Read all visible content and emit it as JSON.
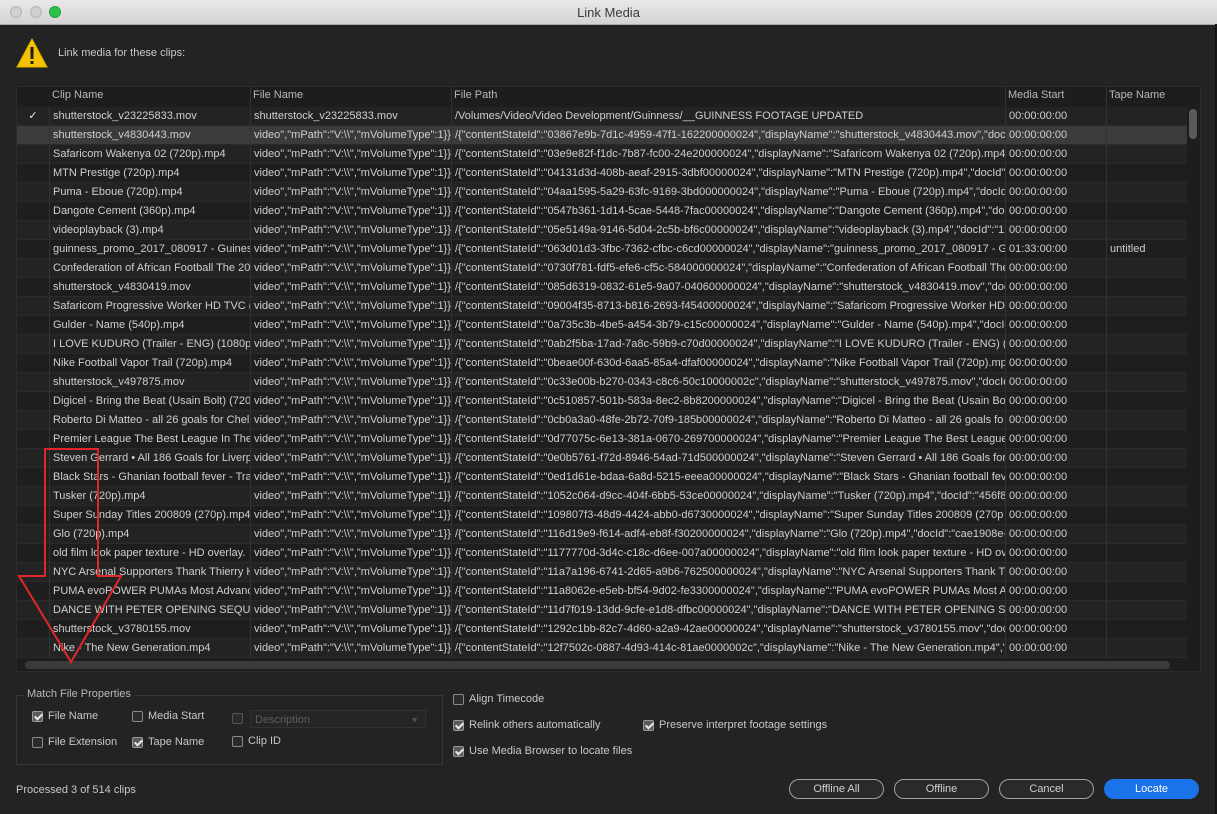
{
  "window": {
    "title": "Link Media"
  },
  "header": {
    "warning_text": "Link media for these clips:"
  },
  "table": {
    "columns": [
      "Clip Name",
      "File Name",
      "File Path",
      "Media Start",
      "Tape Name"
    ],
    "rows": [
      {
        "check": "✓",
        "clip": "shutterstock_v23225833.mov",
        "file": "shutterstock_v23225833.mov",
        "path": "/Volumes/Video/Video Development/Guinness/__GUINNESS FOOTAGE UPDATED",
        "start": "00:00:00:00",
        "tape": "",
        "selected": false
      },
      {
        "check": "",
        "clip": "shutterstock_v4830443.mov",
        "file": "video\",\"mPath\":\"V:\\\\\",\"mVolumeType\":1}}",
        "path": "/{\"contentStateId\":\"03867e9b-7d1c-4959-47f1-162200000024\",\"displayName\":\"shutterstock_v4830443.mov\",\"docId\"",
        "start": "00:00:00:00",
        "tape": "",
        "selected": true
      },
      {
        "check": "",
        "clip": "Safaricom Wakenya 02 (720p).mp4",
        "file": "video\",\"mPath\":\"V:\\\\\",\"mVolumeType\":1}}",
        "path": "/{\"contentStateId\":\"03e9e82f-f1dc-7b87-fc00-24e200000024\",\"displayName\":\"Safaricom Wakenya 02 (720p).mp4\",\"docId\"",
        "start": "00:00:00:00",
        "tape": "",
        "selected": false
      },
      {
        "check": "",
        "clip": "MTN Prestige (720p).mp4",
        "file": "video\",\"mPath\":\"V:\\\\\",\"mVolumeType\":1}}",
        "path": "/{\"contentStateId\":\"04131d3d-408b-aeaf-2915-3dbf00000024\",\"displayName\":\"MTN Prestige (720p).mp4\",\"docId\":\"",
        "start": "00:00:00:00",
        "tape": "",
        "selected": false
      },
      {
        "check": "",
        "clip": "Puma - Eboue (720p).mp4",
        "file": "video\",\"mPath\":\"V:\\\\\",\"mVolumeType\":1}}",
        "path": "/{\"contentStateId\":\"04aa1595-5a29-63fc-9169-3bd000000024\",\"displayName\":\"Puma - Eboue (720p).mp4\",\"docId\"",
        "start": "00:00:00:00",
        "tape": "",
        "selected": false
      },
      {
        "check": "",
        "clip": "Dangote Cement (360p).mp4",
        "file": "video\",\"mPath\":\"V:\\\\\",\"mVolumeType\":1}}",
        "path": "/{\"contentStateId\":\"0547b361-1d14-5cae-5448-7fac00000024\",\"displayName\":\"Dangote Cement (360p).mp4\",\"doc",
        "start": "00:00:00:00",
        "tape": "",
        "selected": false
      },
      {
        "check": "",
        "clip": "videoplayback (3).mp4",
        "file": "video\",\"mPath\":\"V:\\\\\",\"mVolumeType\":1}}",
        "path": "/{\"contentStateId\":\"05e5149a-9146-5d04-2c5b-bf6c00000024\",\"displayName\":\"videoplayback (3).mp4\",\"docId\":\"12",
        "start": "00:00:00:00",
        "tape": "",
        "selected": false
      },
      {
        "check": "",
        "clip": "guinness_promo_2017_080917 - Guines",
        "file": "video\",\"mPath\":\"V:\\\\\",\"mVolumeType\":1}}",
        "path": "/{\"contentStateId\":\"063d01d3-3fbc-7362-cfbc-c6cd00000024\",\"displayName\":\"guinness_promo_2017_080917 - G",
        "start": "01:33:00:00",
        "tape": "untitled",
        "selected": false
      },
      {
        "check": "",
        "clip": "Confederation of African Football The 20",
        "file": "video\",\"mPath\":\"V:\\\\\",\"mVolumeType\":1}}",
        "path": "/{\"contentStateId\":\"0730f781-fdf5-efe6-cf5c-584000000024\",\"displayName\":\"Confederation of African Football The",
        "start": "00:00:00:00",
        "tape": "",
        "selected": false
      },
      {
        "check": "",
        "clip": "shutterstock_v4830419.mov",
        "file": "video\",\"mPath\":\"V:\\\\\",\"mVolumeType\":1}}",
        "path": "/{\"contentStateId\":\"085d6319-0832-61e5-9a07-040600000024\",\"displayName\":\"shutterstock_v4830419.mov\",\"docId\"",
        "start": "00:00:00:00",
        "tape": "",
        "selected": false
      },
      {
        "check": "",
        "clip": "Safaricom Progressive Worker HD TVC (1",
        "file": "video\",\"mPath\":\"V:\\\\\",\"mVolumeType\":1}}",
        "path": "/{\"contentStateId\":\"09004f35-8713-b816-2693-f45400000024\",\"displayName\":\"Safaricom Progressive Worker HD T",
        "start": "00:00:00:00",
        "tape": "",
        "selected": false
      },
      {
        "check": "",
        "clip": "Gulder - Name (540p).mp4",
        "file": "video\",\"mPath\":\"V:\\\\\",\"mVolumeType\":1}}",
        "path": "/{\"contentStateId\":\"0a735c3b-4be5-a454-3b79-c15c00000024\",\"displayName\":\"Gulder - Name (540p).mp4\",\"docId",
        "start": "00:00:00:00",
        "tape": "",
        "selected": false
      },
      {
        "check": "",
        "clip": "I LOVE KUDURO (Trailer - ENG) (1080p).",
        "file": "video\",\"mPath\":\"V:\\\\\",\"mVolumeType\":1}}",
        "path": "/{\"contentStateId\":\"0ab2f5ba-17ad-7a8c-59b9-c70d00000024\",\"displayName\":\"I LOVE KUDURO (Trailer - ENG) (10",
        "start": "00:00:00:00",
        "tape": "",
        "selected": false
      },
      {
        "check": "",
        "clip": "Nike Football Vapor Trail (720p).mp4",
        "file": "video\",\"mPath\":\"V:\\\\\",\"mVolumeType\":1}}",
        "path": "/{\"contentStateId\":\"0beae00f-630d-6aa5-85a4-dfaf00000024\",\"displayName\":\"Nike Football Vapor Trail (720p).mp",
        "start": "00:00:00:00",
        "tape": "",
        "selected": false
      },
      {
        "check": "",
        "clip": "shutterstock_v497875.mov",
        "file": "video\",\"mPath\":\"V:\\\\\",\"mVolumeType\":1}}",
        "path": "/{\"contentStateId\":\"0c33e00b-b270-0343-c8c6-50c10000002c\",\"displayName\":\"shutterstock_v497875.mov\",\"docId",
        "start": "00:00:00:00",
        "tape": "",
        "selected": false
      },
      {
        "check": "",
        "clip": "Digicel - Bring the Beat (Usain Bolt) (720",
        "file": "video\",\"mPath\":\"V:\\\\\",\"mVolumeType\":1}}",
        "path": "/{\"contentStateId\":\"0c510857-501b-583a-8ec2-8b8200000024\",\"displayName\":\"Digicel - Bring the Beat (Usain Bolt",
        "start": "00:00:00:00",
        "tape": "",
        "selected": false
      },
      {
        "check": "",
        "clip": "Roberto Di Matteo - all 26 goals for Chel",
        "file": "video\",\"mPath\":\"V:\\\\\",\"mVolumeType\":1}}",
        "path": "/{\"contentStateId\":\"0cb0a3a0-48fe-2b72-70f9-185b00000024\",\"displayName\":\"Roberto Di Matteo - all 26 goals fo",
        "start": "00:00:00:00",
        "tape": "",
        "selected": false
      },
      {
        "check": "",
        "clip": "Premier League The Best League In The W",
        "file": "video\",\"mPath\":\"V:\\\\\",\"mVolumeType\":1}}",
        "path": "/{\"contentStateId\":\"0d77075c-6e13-381a-0670-269700000024\",\"displayName\":\"Premier League The Best League I",
        "start": "00:00:00:00",
        "tape": "",
        "selected": false
      },
      {
        "check": "",
        "clip": "Steven Gerrard • All 186 Goals for Liverp",
        "file": "video\",\"mPath\":\"V:\\\\\",\"mVolumeType\":1}}",
        "path": "/{\"contentStateId\":\"0e0b5761-f72d-8946-54ad-71d500000024\",\"displayName\":\"Steven Gerrard • All 186 Goals for",
        "start": "00:00:00:00",
        "tape": "",
        "selected": false
      },
      {
        "check": "",
        "clip": "Black Stars - Ghanian football fever - Trai",
        "file": "video\",\"mPath\":\"V:\\\\\",\"mVolumeType\":1}}",
        "path": "/{\"contentStateId\":\"0ed1d61e-bdaa-6a8d-5215-eeea00000024\",\"displayName\":\"Black Stars - Ghanian football feve",
        "start": "00:00:00:00",
        "tape": "",
        "selected": false
      },
      {
        "check": "",
        "clip": "Tusker (720p).mp4",
        "file": "video\",\"mPath\":\"V:\\\\\",\"mVolumeType\":1}}",
        "path": "/{\"contentStateId\":\"1052c064-d9cc-404f-6bb5-53ce00000024\",\"displayName\":\"Tusker (720p).mp4\",\"docId\":\"456f84",
        "start": "00:00:00:00",
        "tape": "",
        "selected": false
      },
      {
        "check": "",
        "clip": "Super Sunday Titles 200809 (270p).mp4",
        "file": "video\",\"mPath\":\"V:\\\\\",\"mVolumeType\":1}}",
        "path": "/{\"contentStateId\":\"109807f3-48d9-4424-abb0-d6730000024\",\"displayName\":\"Super Sunday Titles 200809 (270p",
        "start": "00:00:00:00",
        "tape": "",
        "selected": false
      },
      {
        "check": "",
        "clip": "Glo (720p).mp4",
        "file": "video\",\"mPath\":\"V:\\\\\",\"mVolumeType\":1}}",
        "path": "/{\"contentStateId\":\"116d19e9-f614-adf4-eb8f-f30200000024\",\"displayName\":\"Glo (720p).mp4\",\"docId\":\"cae1908e-",
        "start": "00:00:00:00",
        "tape": "",
        "selected": false
      },
      {
        "check": "",
        "clip": "old film look paper texture - HD overlay.",
        "file": "video\",\"mPath\":\"V:\\\\\",\"mVolumeType\":1}}",
        "path": "/{\"contentStateId\":\"1177770d-3d4c-c18c-d6ee-007a00000024\",\"displayName\":\"old film look paper texture - HD ov",
        "start": "00:00:00:00",
        "tape": "",
        "selected": false
      },
      {
        "check": "",
        "clip": "NYC Arsenal Supporters Thank Thierry H",
        "file": "video\",\"mPath\":\"V:\\\\\",\"mVolumeType\":1}}",
        "path": "/{\"contentStateId\":\"11a7a196-6741-2d65-a9b6-762500000024\",\"displayName\":\"NYC Arsenal Supporters Thank Th",
        "start": "00:00:00:00",
        "tape": "",
        "selected": false
      },
      {
        "check": "",
        "clip": "PUMA evoPOWER  PUMAs Most Advanc",
        "file": "video\",\"mPath\":\"V:\\\\\",\"mVolumeType\":1}}",
        "path": "/{\"contentStateId\":\"11a8062e-e5eb-bf54-9d02-fe3300000024\",\"displayName\":\"PUMA evoPOWER  PUMAs Most A",
        "start": "00:00:00:00",
        "tape": "",
        "selected": false
      },
      {
        "check": "",
        "clip": "DANCE WITH PETER OPENING SEQUENC",
        "file": "video\",\"mPath\":\"V:\\\\\",\"mVolumeType\":1}}",
        "path": "/{\"contentStateId\":\"11d7f019-13dd-9cfe-e1d8-dfbc00000024\",\"displayName\":\"DANCE WITH PETER OPENING SEQ",
        "start": "00:00:00:00",
        "tape": "",
        "selected": false
      },
      {
        "check": "",
        "clip": "shutterstock_v3780155.mov",
        "file": "video\",\"mPath\":\"V:\\\\\",\"mVolumeType\":1}}",
        "path": "/{\"contentStateId\":\"1292c1bb-82c7-4d60-a2a9-42ae00000024\",\"displayName\":\"shutterstock_v3780155.mov\",\"docId",
        "start": "00:00:00:00",
        "tape": "",
        "selected": false
      },
      {
        "check": "",
        "clip": "Nike - The New Generation.mp4",
        "file": "video\",\"mPath\":\"V:\\\\\",\"mVolumeType\":1}}",
        "path": "/{\"contentStateId\":\"12f7502c-0887-4d93-414c-81ae0000002c\",\"displayName\":\"Nike - The New Generation.mp4\",\"d",
        "start": "00:00:00:00",
        "tape": "",
        "selected": false
      }
    ]
  },
  "match": {
    "legend": "Match File Properties",
    "file_name": "File Name",
    "media_start": "Media Start",
    "description": "Description",
    "file_extension": "File Extension",
    "tape_name": "Tape Name",
    "clip_id": "Clip ID"
  },
  "options": {
    "align_timecode": "Align Timecode",
    "relink_others": "Relink others automatically",
    "preserve_interpret": "Preserve interpret footage settings",
    "use_media_browser": "Use Media Browser to locate files"
  },
  "status": "Processed 3 of 514 clips",
  "buttons": {
    "offline_all": "Offline All",
    "offline": "Offline",
    "cancel": "Cancel",
    "locate": "Locate"
  },
  "colors": {
    "accent": "#1a73e8",
    "annotation": "#e0262a",
    "warning": "#f5c400"
  },
  "icons": {
    "warning": "warning-triangle-icon",
    "annotation": "red-arrow-annotation"
  }
}
